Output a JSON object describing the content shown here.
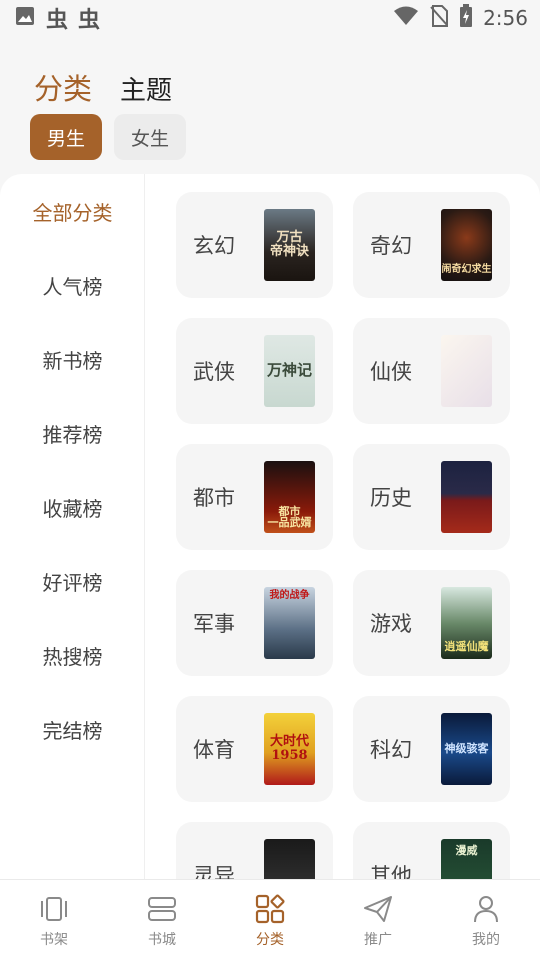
{
  "status_bar": {
    "time": "2:56",
    "app_glyph_1": "虫",
    "app_glyph_2": "虫",
    "icons": [
      "image-icon",
      "wifi-icon",
      "no-sim-icon",
      "battery-icon"
    ]
  },
  "header": {
    "tabs": [
      {
        "label": "分类",
        "active": true
      },
      {
        "label": "主题",
        "active": false
      }
    ]
  },
  "gender": {
    "male": "男生",
    "female": "女生",
    "selected": "男生"
  },
  "sidebar": {
    "items": [
      {
        "label": "全部分类",
        "active": true
      },
      {
        "label": "人气榜"
      },
      {
        "label": "新书榜"
      },
      {
        "label": "推荐榜"
      },
      {
        "label": "收藏榜"
      },
      {
        "label": "好评榜"
      },
      {
        "label": "热搜榜"
      },
      {
        "label": "完结榜"
      }
    ]
  },
  "categories": [
    {
      "label": "玄幻",
      "cover_text": "万古\n帝神诀"
    },
    {
      "label": "奇幻",
      "cover_text": "闹奇幻求生"
    },
    {
      "label": "武侠",
      "cover_text": "万神记"
    },
    {
      "label": "仙侠",
      "cover_text": ""
    },
    {
      "label": "都市",
      "cover_text": "都市\n一品武婿"
    },
    {
      "label": "历史",
      "cover_text": ""
    },
    {
      "label": "军事",
      "cover_text": "我的战争"
    },
    {
      "label": "游戏",
      "cover_text": "逍遥仙魔"
    },
    {
      "label": "体育",
      "cover_text": "大时代\n1958"
    },
    {
      "label": "科幻",
      "cover_text": "神级骇客"
    },
    {
      "label": "灵异",
      "cover_text": ""
    },
    {
      "label": "其他",
      "cover_text": "漫威"
    }
  ],
  "bottom_nav": {
    "items": [
      {
        "label": "书架",
        "icon": "bookshelf-icon"
      },
      {
        "label": "书城",
        "icon": "bookstore-icon"
      },
      {
        "label": "分类",
        "icon": "category-icon",
        "active": true
      },
      {
        "label": "推广",
        "icon": "send-icon"
      },
      {
        "label": "我的",
        "icon": "profile-icon"
      }
    ]
  },
  "colors": {
    "accent": "#a5622a",
    "card_bg": "#f5f5f5",
    "page_bg": "#f6f6f6"
  }
}
